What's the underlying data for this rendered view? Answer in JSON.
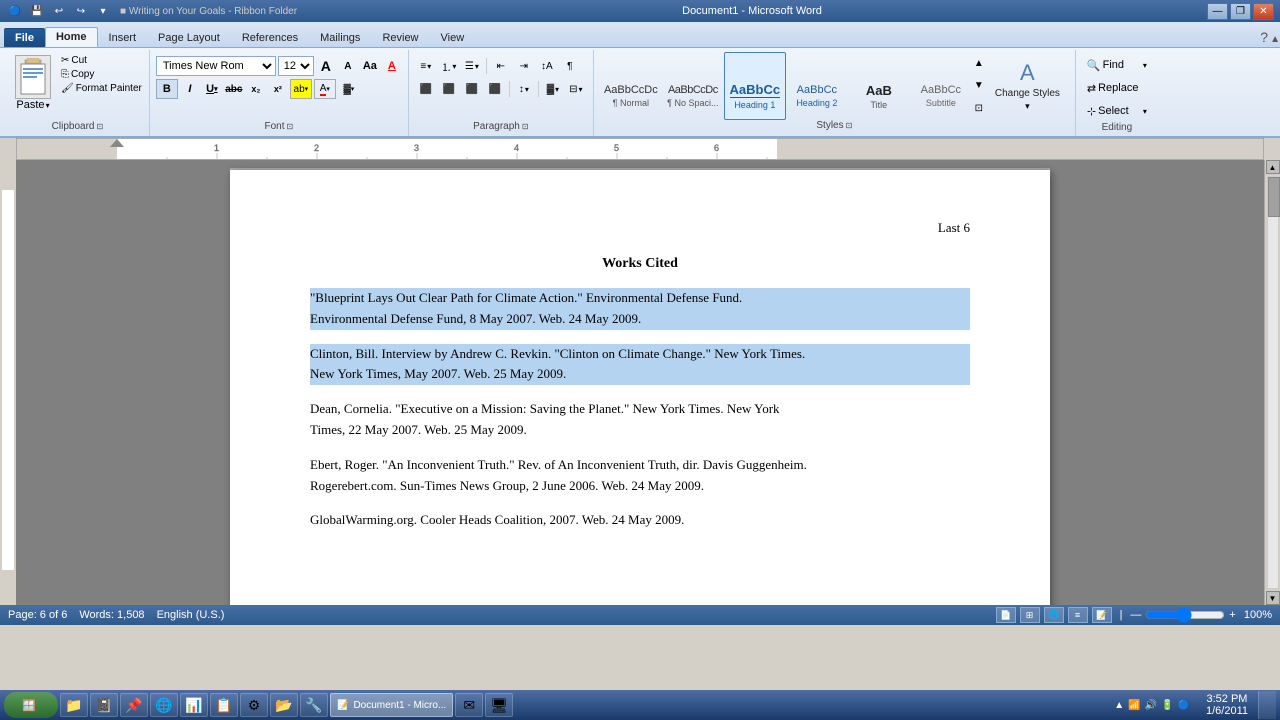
{
  "titlebar": {
    "title": "Document1 - Microsoft Word",
    "qa_icons": [
      "💾",
      "↩",
      "↪",
      "🖨"
    ],
    "min": "—",
    "restore": "❐",
    "close": "✕"
  },
  "ribbon_tabs": [
    {
      "label": "File",
      "active": false
    },
    {
      "label": "Home",
      "active": true
    },
    {
      "label": "Insert",
      "active": false
    },
    {
      "label": "Page Layout",
      "active": false
    },
    {
      "label": "References",
      "active": false
    },
    {
      "label": "Mailings",
      "active": false
    },
    {
      "label": "Review",
      "active": false
    },
    {
      "label": "View",
      "active": false
    }
  ],
  "clipboard": {
    "label": "Clipboard",
    "paste_label": "Paste",
    "cut_label": "Cut",
    "copy_label": "Copy",
    "format_painter_label": "Format Painter"
  },
  "font": {
    "label": "Font",
    "name": "Times New Rom",
    "size": "12",
    "bold": "B",
    "italic": "I",
    "underline": "U",
    "strikethrough": "abc",
    "subscript": "x₂",
    "superscript": "x²",
    "grow": "A",
    "shrink": "A",
    "case": "Aa",
    "clear": "A",
    "highlight": "A",
    "color": "A"
  },
  "paragraph": {
    "label": "Paragraph",
    "bullets": "≡",
    "numbering": "≡",
    "multilevel": "≡",
    "indent_dec": "⇤",
    "indent_inc": "⇥",
    "sort": "↕",
    "show_marks": "¶",
    "align_left": "≡",
    "align_center": "≡",
    "align_right": "≡",
    "justify": "≡",
    "line_spacing": "↕",
    "shading": "▓",
    "border": "⊟"
  },
  "styles": {
    "label": "Styles",
    "items": [
      {
        "name": "Normal",
        "sublabel": "¶ Normal",
        "type": "normal"
      },
      {
        "name": "No Spaci...",
        "sublabel": "¶ No Spaci...",
        "type": "nospacing",
        "selected": false
      },
      {
        "name": "Heading 1",
        "sublabel": "Heading 1",
        "type": "h1",
        "selected": true
      },
      {
        "name": "Heading 2",
        "sublabel": "Heading 2",
        "type": "h2"
      },
      {
        "name": "Title",
        "sublabel": "Title",
        "type": "title"
      },
      {
        "name": "Subtitle",
        "sublabel": "Subtitle",
        "type": "subtitle"
      }
    ],
    "change_styles_label": "Change\nStyles",
    "change_styles_arrow": "▾"
  },
  "editing": {
    "label": "Editing",
    "find_label": "Find",
    "replace_label": "Replace",
    "select_label": "Select"
  },
  "document": {
    "header_right": "Last 6",
    "page_title": "Works Cited",
    "citations": [
      {
        "id": 1,
        "text": "\"Blueprint Lays Out Clear Path for Climate Action.\" Environmental Defense Fund.\nEnvironmental Defense Fund, 8 May 2007. Web. 24 May 2009.",
        "highlighted": true
      },
      {
        "id": 2,
        "text": "Clinton, Bill. Interview by Andrew C. Revkin. \"Clinton on Climate Change.\" New York Times.\nNew York Times, May 2007. Web. 25 May 2009.",
        "highlighted": true
      },
      {
        "id": 3,
        "text": "Dean, Cornelia. \"Executive on a Mission: Saving the Planet.\" New York Times. New York\nTimes, 22 May 2007. Web. 25 May 2009.",
        "highlighted": false
      },
      {
        "id": 4,
        "text": "Ebert, Roger. \"An Inconvenient Truth.\" Rev. of An Inconvenient Truth, dir. Davis Guggenheim.\nRogerebert.com. Sun-Times News Group, 2 June 2006. Web. 24 May 2009.",
        "highlighted": false
      },
      {
        "id": 5,
        "text": "GlobalWarming.org. Cooler Heads Coalition, 2007. Web. 24 May 2009.",
        "highlighted": false
      }
    ]
  },
  "status_bar": {
    "page_info": "Page: 6 of 6",
    "word_count": "Words: 1,508",
    "language": "English (U.S.)",
    "zoom": "100%"
  },
  "taskbar": {
    "start_label": "Start",
    "time": "3:52 PM",
    "date": "1/6/2011",
    "app_label": "Document1 - Micro...",
    "apps": [
      "🔵",
      "📓",
      "📌",
      "🌐",
      "📊",
      "📋",
      "⚙",
      "📁",
      "🔧",
      "📝",
      "✉",
      "🖥"
    ]
  }
}
